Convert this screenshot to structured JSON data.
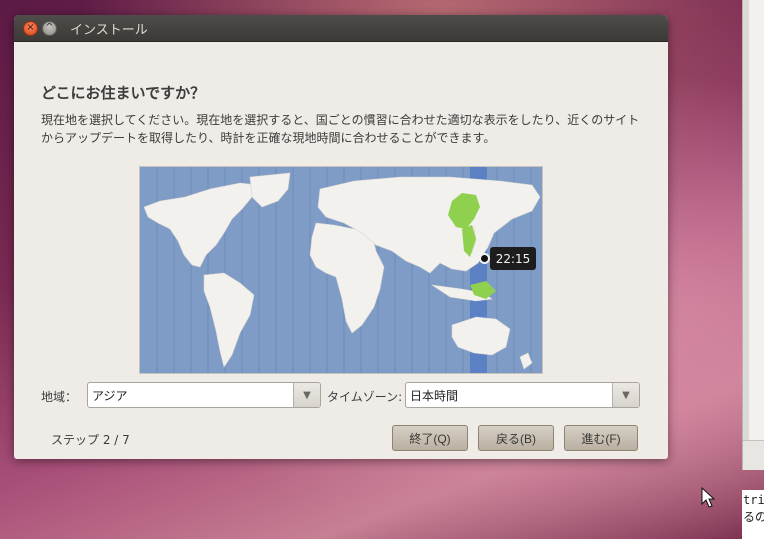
{
  "window": {
    "title": "インストール",
    "close_glyph": "×",
    "maximize_glyph": "^"
  },
  "page": {
    "heading": "どこにお住まいですか？",
    "description": "現在地を選択してください。現在地を選択すると、国ごとの慣習に合わせた適切な表示をしたり、近くのサイトからアップデートを取得したり、時計を正確な現地時間に合わせることができます。"
  },
  "map": {
    "selected_time": "22:15",
    "ocean_color": "#7f9cc7",
    "land_color": "#f2f1ee",
    "highlight_color": "#8fd14f",
    "timezone_band_color": "#5b81c4"
  },
  "region": {
    "label": "地域：",
    "value": "アジア"
  },
  "timezone": {
    "label": "タイムゾーン:",
    "value": "日本時間"
  },
  "footer": {
    "step": "ステップ 2 / 7",
    "quit_label": "終了(Q)",
    "back_label": "戻る(B)",
    "forward_label": "進む(F)"
  },
  "terminal": {
    "lines": [
      "tri",
      "るの"
    ]
  }
}
